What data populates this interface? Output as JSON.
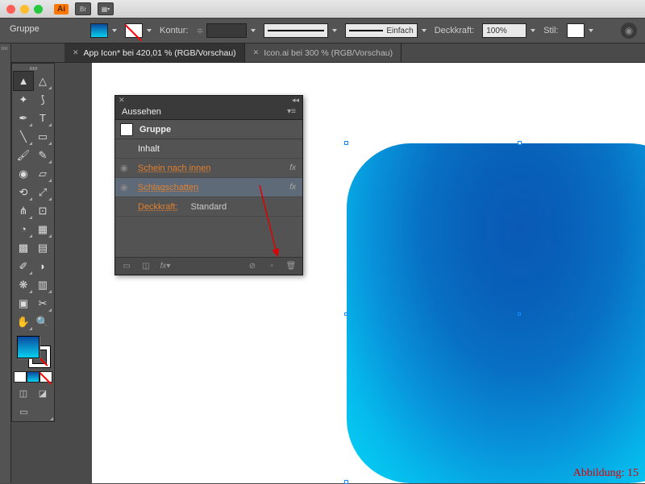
{
  "title_bar": {
    "app_badge": "Ai",
    "bridge": "Br"
  },
  "control_bar": {
    "selection_label": "Gruppe",
    "stroke_label": "Kontur:",
    "profile_label": "Einfach",
    "opacity_label": "Deckkraft:",
    "opacity_value": "100%",
    "style_label": "Stil:"
  },
  "tabs": [
    {
      "label": "App Icon* bei 420,01 % (RGB/Vorschau)",
      "active": true
    },
    {
      "label": "Icon.ai bei 300 % (RGB/Vorschau)",
      "active": false
    }
  ],
  "appearance_panel": {
    "title": "Aussehen",
    "object_label": "Gruppe",
    "rows": [
      {
        "label": "Inhalt"
      },
      {
        "label": "Schein nach innen",
        "fx": "fx",
        "link": true
      },
      {
        "label": "Schlagschatten",
        "fx": "fx",
        "link": true,
        "selected": true
      },
      {
        "label": "Deckkraft:",
        "value": "Standard",
        "link": true
      }
    ],
    "footer_fx": "fx"
  },
  "caption": "Abbildung: 15"
}
